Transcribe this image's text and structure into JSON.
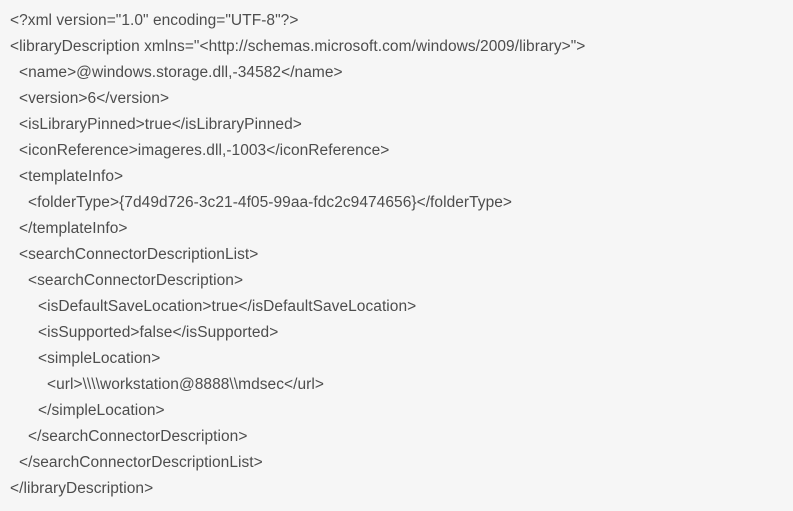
{
  "code": {
    "lines": [
      {
        "text": "<?xml version=\"1.0\" encoding=\"UTF-8\"?>",
        "indent": 0
      },
      {
        "text": "<libraryDescription xmlns=\"<http://schemas.microsoft.com/windows/2009/library>\">",
        "indent": 0
      },
      {
        "text": "<name>@windows.storage.dll,-34582</name>",
        "indent": 1
      },
      {
        "text": "<version>6</version>",
        "indent": 1
      },
      {
        "text": "<isLibraryPinned>true</isLibraryPinned>",
        "indent": 1
      },
      {
        "text": "<iconReference>imageres.dll,-1003</iconReference>",
        "indent": 1
      },
      {
        "text": "<templateInfo>",
        "indent": 1
      },
      {
        "text": "<folderType>{7d49d726-3c21-4f05-99aa-fdc2c9474656}</folderType>",
        "indent": 2
      },
      {
        "text": "</templateInfo>",
        "indent": 1
      },
      {
        "text": "<searchConnectorDescriptionList>",
        "indent": 1
      },
      {
        "text": "<searchConnectorDescription>",
        "indent": 2
      },
      {
        "text": "<isDefaultSaveLocation>true</isDefaultSaveLocation>",
        "indent": 3
      },
      {
        "text": "<isSupported>false</isSupported>",
        "indent": 3
      },
      {
        "text": "<simpleLocation>",
        "indent": 3
      },
      {
        "text": "<url>\\\\\\\\workstation@8888\\\\mdsec</url>",
        "indent": 4
      },
      {
        "text": "</simpleLocation>",
        "indent": 3
      },
      {
        "text": "</searchConnectorDescription>",
        "indent": 2
      },
      {
        "text": "</searchConnectorDescriptionList>",
        "indent": 1
      },
      {
        "text": "</libraryDescription>",
        "indent": 0
      }
    ]
  }
}
